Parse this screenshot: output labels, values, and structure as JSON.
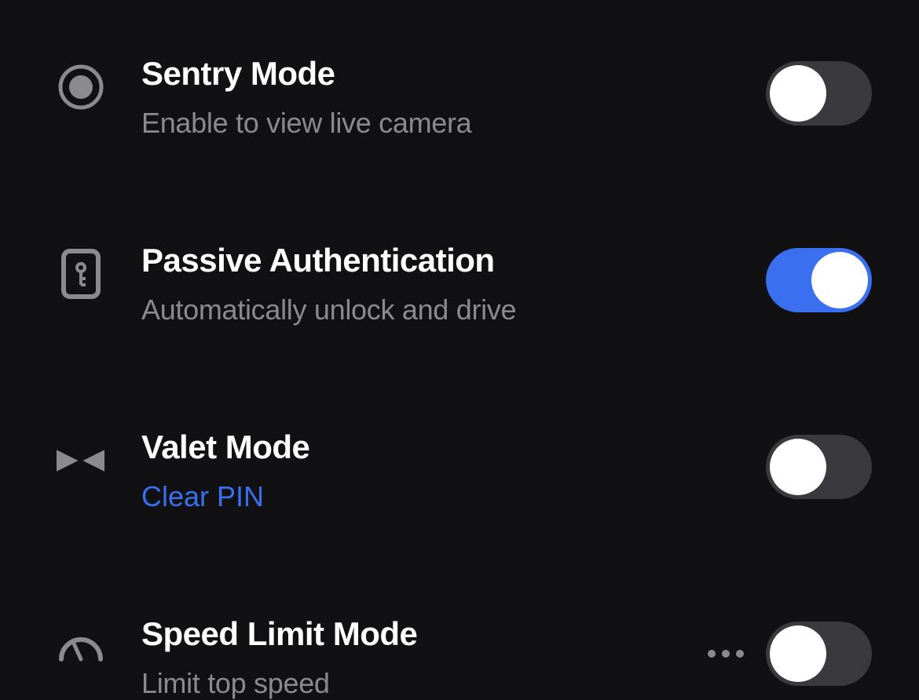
{
  "settings": [
    {
      "icon": "record-circle-icon",
      "title": "Sentry Mode",
      "subtitle": "Enable to view live camera",
      "subtitle_is_link": false,
      "toggle_on": false,
      "has_more": false
    },
    {
      "icon": "key-card-icon",
      "title": "Passive Authentication",
      "subtitle": "Automatically unlock and drive",
      "subtitle_is_link": false,
      "toggle_on": true,
      "has_more": false
    },
    {
      "icon": "bowtie-icon",
      "title": "Valet Mode",
      "subtitle": "Clear PIN",
      "subtitle_is_link": true,
      "toggle_on": false,
      "has_more": false
    },
    {
      "icon": "gauge-icon",
      "title": "Speed Limit Mode",
      "subtitle": "Limit top speed",
      "subtitle_is_link": false,
      "toggle_on": false,
      "has_more": true
    }
  ],
  "colors": {
    "background": "#111113",
    "text_primary": "#ffffff",
    "text_secondary": "#8a8a8f",
    "accent": "#3a6ff0",
    "toggle_off": "#39393e"
  }
}
